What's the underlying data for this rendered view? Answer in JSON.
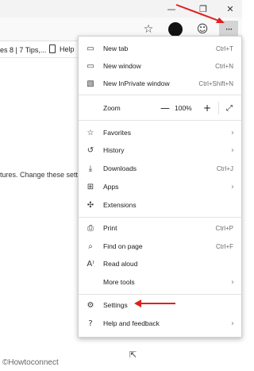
{
  "titlebar": {
    "minimize_glyph": "—",
    "maximize_glyph": "❐",
    "close_glyph": "✕"
  },
  "toolbar": {
    "more_glyph": "···"
  },
  "bookmarks": {
    "item1": "es 8 | 7 Tips,...",
    "item2": "Help"
  },
  "page": {
    "body_text": "tures. Change these sett",
    "watermark": "©Howtoconnect"
  },
  "menu": {
    "items": [
      {
        "label": "New tab",
        "shortcut": "Ctrl+T",
        "icon": "new-tab-icon"
      },
      {
        "label": "New window",
        "shortcut": "Ctrl+N",
        "icon": "new-window-icon"
      },
      {
        "label": "New InPrivate window",
        "shortcut": "Ctrl+Shift+N",
        "icon": "inprivate-icon"
      },
      {
        "label": "Zoom",
        "shortcut": "",
        "icon": ""
      },
      {
        "label": "Favorites",
        "shortcut": "",
        "icon": "star-icon"
      },
      {
        "label": "History",
        "shortcut": "",
        "icon": "history-icon"
      },
      {
        "label": "Downloads",
        "shortcut": "Ctrl+J",
        "icon": "download-icon"
      },
      {
        "label": "Apps",
        "shortcut": "",
        "icon": "apps-icon"
      },
      {
        "label": "Extensions",
        "shortcut": "",
        "icon": "extensions-icon"
      },
      {
        "label": "Print",
        "shortcut": "Ctrl+P",
        "icon": "print-icon"
      },
      {
        "label": "Find on page",
        "shortcut": "Ctrl+F",
        "icon": "find-icon"
      },
      {
        "label": "Read aloud",
        "shortcut": "",
        "icon": "read-aloud-icon"
      },
      {
        "label": "More tools",
        "shortcut": "",
        "icon": ""
      },
      {
        "label": "Settings",
        "shortcut": "",
        "icon": "gear-icon"
      },
      {
        "label": "Help and feedback",
        "shortcut": "",
        "icon": "help-icon"
      }
    ],
    "zoom": {
      "minus": "—",
      "value": "100%",
      "plus": "+"
    },
    "chevron": "›"
  },
  "colors": {
    "annotation_arrow": "#e02020",
    "more_button_bg": "#d4d4d4"
  }
}
